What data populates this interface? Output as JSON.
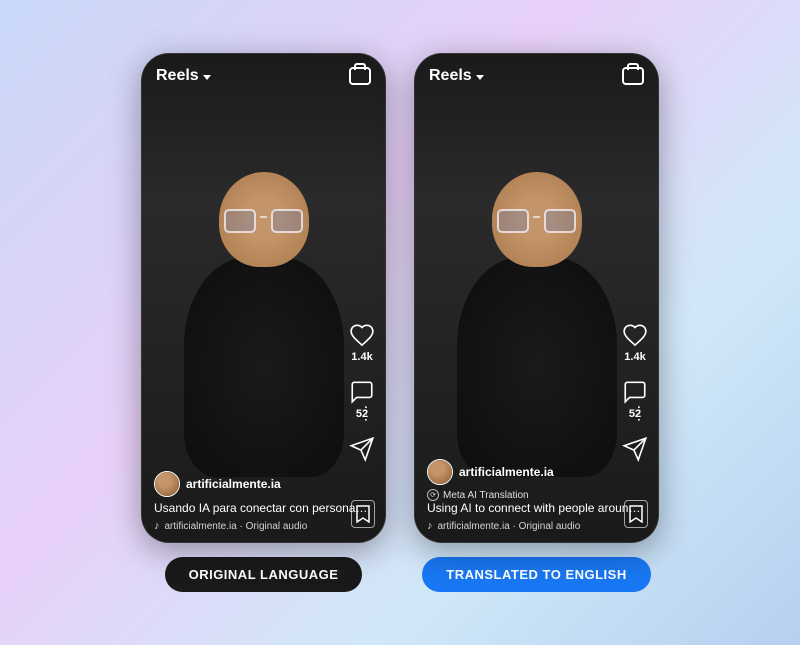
{
  "background": {
    "gradient_start": "#c8d8f8",
    "gradient_end": "#b8d0f0"
  },
  "left_phone": {
    "top_bar": {
      "title": "Reels",
      "chevron": true,
      "camera_label": "camera-icon"
    },
    "sidebar": {
      "like_count": "1.4k",
      "comment_count": "52"
    },
    "bottom": {
      "username": "artificialmente.ia",
      "translation_badge": null,
      "caption": "Usando IA para conectar con personas de ...",
      "audio": "♪  artificialmente.ia · Original audio"
    },
    "label": "ORIGINAL LANGUAGE"
  },
  "right_phone": {
    "top_bar": {
      "title": "Reels",
      "chevron": true,
      "camera_label": "camera-icon"
    },
    "sidebar": {
      "like_count": "1.4k",
      "comment_count": "52"
    },
    "bottom": {
      "username": "artificialmente.ia",
      "translation_badge": "Meta AI Translation",
      "caption": "Using AI to connect with people around ...",
      "audio": "♪  artificialmente.ia · Original audio"
    },
    "label": "TRANSLATED TO ENGLISH"
  }
}
